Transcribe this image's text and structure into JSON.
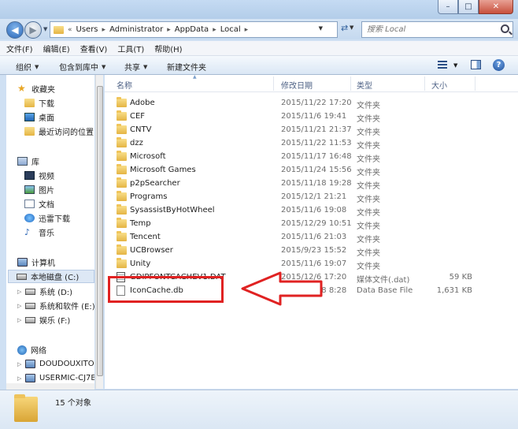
{
  "window": {
    "minimize": "–",
    "maximize": "□",
    "close": "✕"
  },
  "address": {
    "chevron": "«",
    "crumbs": [
      "Users",
      "Administrator",
      "AppData",
      "Local"
    ],
    "search_placeholder": "搜索 Local"
  },
  "menu": [
    "文件(F)",
    "编辑(E)",
    "查看(V)",
    "工具(T)",
    "帮助(H)"
  ],
  "commands": {
    "organize": "组织",
    "include": "包含到库中",
    "share": "共享",
    "new_folder": "新建文件夹"
  },
  "nav": {
    "favorites": "收藏夹",
    "downloads": "下载",
    "desktop": "桌面",
    "recent": "最近访问的位置",
    "libraries": "库",
    "videos": "视频",
    "pictures": "图片",
    "documents": "文档",
    "xunlei": "迅雷下载",
    "music": "音乐",
    "computer": "计算机",
    "drive_c": "本地磁盘 (C:)",
    "drive_d": "系统 (D:)",
    "drive_e": "系统和软件 (E:)",
    "drive_f": "娱乐 (F:)",
    "network": "网络",
    "net1": "DOUDOUXITON",
    "net2": "USERMIC-CJ7B"
  },
  "columns": {
    "name": "名称",
    "date": "修改日期",
    "type": "类型",
    "size": "大小"
  },
  "files": [
    {
      "name": "Adobe",
      "date": "2015/11/22 17:20",
      "type": "文件夹",
      "size": "",
      "icon": "folder"
    },
    {
      "name": "CEF",
      "date": "2015/11/6 19:41",
      "type": "文件夹",
      "size": "",
      "icon": "folder"
    },
    {
      "name": "CNTV",
      "date": "2015/11/21 21:37",
      "type": "文件夹",
      "size": "",
      "icon": "folder"
    },
    {
      "name": "dzz",
      "date": "2015/11/22 11:53",
      "type": "文件夹",
      "size": "",
      "icon": "folder"
    },
    {
      "name": "Microsoft",
      "date": "2015/11/17 16:48",
      "type": "文件夹",
      "size": "",
      "icon": "folder"
    },
    {
      "name": "Microsoft Games",
      "date": "2015/11/24 15:56",
      "type": "文件夹",
      "size": "",
      "icon": "folder"
    },
    {
      "name": "p2pSearcher",
      "date": "2015/11/18 19:28",
      "type": "文件夹",
      "size": "",
      "icon": "folder"
    },
    {
      "name": "Programs",
      "date": "2015/12/1 21:21",
      "type": "文件夹",
      "size": "",
      "icon": "folder"
    },
    {
      "name": "SysassistByHotWheel",
      "date": "2015/11/6 19:08",
      "type": "文件夹",
      "size": "",
      "icon": "folder"
    },
    {
      "name": "Temp",
      "date": "2015/12/29 10:51",
      "type": "文件夹",
      "size": "",
      "icon": "folder"
    },
    {
      "name": "Tencent",
      "date": "2015/11/6 21:03",
      "type": "文件夹",
      "size": "",
      "icon": "folder"
    },
    {
      "name": "UCBrowser",
      "date": "2015/9/23 15:52",
      "type": "文件夹",
      "size": "",
      "icon": "folder"
    },
    {
      "name": "Unity",
      "date": "2015/11/6 19:07",
      "type": "文件夹",
      "size": "",
      "icon": "folder"
    },
    {
      "name": "GDIPFONTCACHEV1.DAT",
      "date": "2015/12/6 17:20",
      "type": "媒体文件(.dat)",
      "size": "59 KB",
      "icon": "dat-file"
    },
    {
      "name": "IconCache.db",
      "date": "2015/12/28 8:28",
      "type": "Data Base File",
      "size": "1,631 KB",
      "icon": "db-file"
    }
  ],
  "status": {
    "count": "15 个对象"
  },
  "colors": {
    "highlight": "#e02222"
  }
}
